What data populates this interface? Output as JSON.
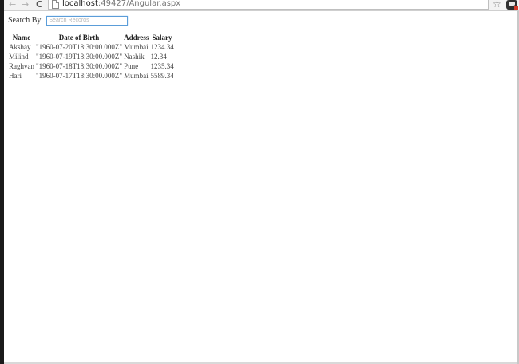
{
  "browser": {
    "url_host": "localhost",
    "url_rest": ":49427/Angular.aspx",
    "back_icon": "←",
    "forward_icon": "→",
    "reload_icon": "C",
    "star_icon": "☆"
  },
  "search": {
    "label": "Search By",
    "placeholder": "Search Records",
    "value": ""
  },
  "table": {
    "headers": [
      "Name",
      "Date of Birth",
      "Address",
      "Salary"
    ],
    "rows": [
      [
        "Akshay",
        "\"1960-07-20T18:30:00.000Z\"",
        "Mumbai",
        "1234.34"
      ],
      [
        "Milind",
        "\"1960-07-19T18:30:00.000Z\"",
        "Nashik",
        "12.34"
      ],
      [
        "Raghvan",
        "\"1960-07-18T18:30:00.000Z\"",
        "Pune",
        "1235.34"
      ],
      [
        "Hari",
        "\"1960-07-17T18:30:00.000Z\"",
        "Mumbai",
        "5589.34"
      ]
    ]
  },
  "colors": {
    "input_focus_border": "#5b9dd9",
    "text": "#444444"
  }
}
